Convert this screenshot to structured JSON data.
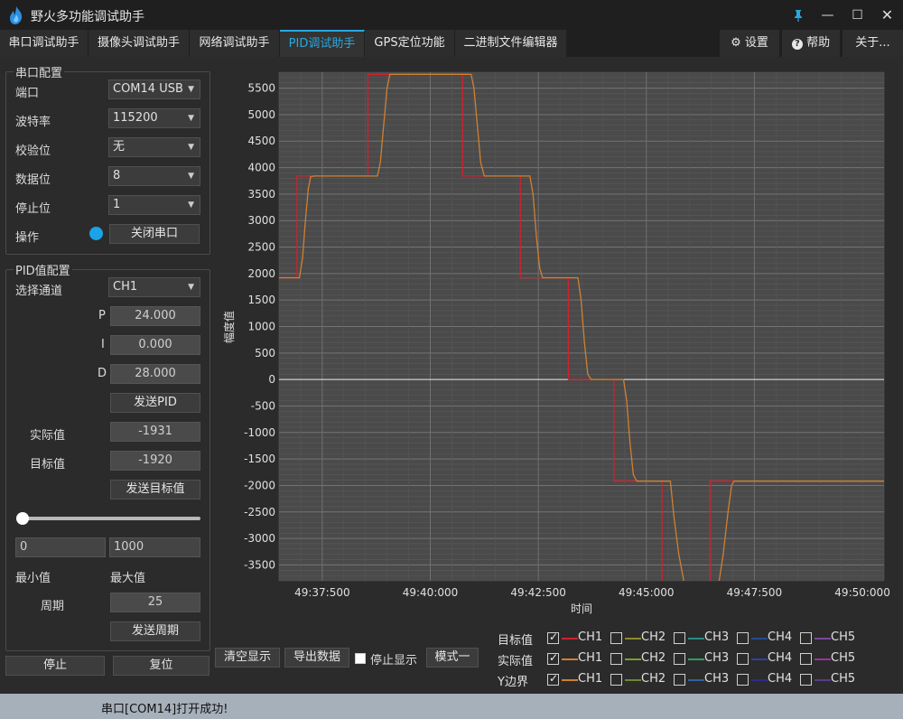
{
  "window": {
    "title": "野火多功能调试助手"
  },
  "tabs": [
    {
      "label": "串口调试助手"
    },
    {
      "label": "摄像头调试助手"
    },
    {
      "label": "网络调试助手"
    },
    {
      "label": "PID调试助手"
    },
    {
      "label": "GPS定位功能"
    },
    {
      "label": "二进制文件编辑器"
    }
  ],
  "topbuttons": {
    "settings": "设置",
    "help": "帮助",
    "about": "关于..."
  },
  "serial": {
    "title": "串口配置",
    "port_label": "端口",
    "port_value": "COM14 USB",
    "baud_label": "波特率",
    "baud_value": "115200",
    "parity_label": "校验位",
    "parity_value": "无",
    "databits_label": "数据位",
    "databits_value": "8",
    "stopbits_label": "停止位",
    "stopbits_value": "1",
    "op_label": "操作",
    "close_button": "关闭串口"
  },
  "pid": {
    "title": "PID值配置",
    "channel_label": "选择通道",
    "channel_value": "CH1",
    "p_label": "P",
    "p_value": "24.000",
    "i_label": "I",
    "i_value": "0.000",
    "d_label": "D",
    "d_value": "28.000",
    "send_pid": "发送PID",
    "actual_label": "实际值",
    "actual_value": "-1931",
    "target_label": "目标值",
    "target_value": "-1920",
    "send_target": "发送目标值",
    "slider_min_value": "0",
    "slider_max_value": "1000",
    "min_label": "最小值",
    "max_label": "最大值",
    "period_label": "周期",
    "period_value": "25",
    "send_period": "发送周期"
  },
  "bottom": {
    "stop": "停止",
    "reset": "复位",
    "clear": "清空显示",
    "export": "导出数据",
    "stop_display": "停止显示",
    "mode": "模式一"
  },
  "legend": {
    "rows": [
      {
        "label": "目标值",
        "checked": [
          true,
          false,
          false,
          false,
          false
        ]
      },
      {
        "label": "实际值",
        "checked": [
          true,
          false,
          false,
          false,
          false
        ]
      },
      {
        "label": "Y边界",
        "checked": [
          true,
          false,
          false,
          false,
          false
        ]
      }
    ],
    "channels": [
      "CH1",
      "CH2",
      "CH3",
      "CH4",
      "CH5"
    ],
    "row_colors": [
      [
        "#d2202e",
        "#8a8a2a",
        "#2a8a8a",
        "#2a4a8a",
        "#7a4a9a"
      ],
      [
        "#d08030",
        "#7aa030",
        "#30a060",
        "#3040a0",
        "#a030a0"
      ],
      [
        "#d08030",
        "#6a8a30",
        "#3060a0",
        "#302a8a",
        "#5a3a8a"
      ]
    ]
  },
  "status": {
    "text": "串口[COM14]打开成功!"
  },
  "chart_data": {
    "type": "line",
    "xlabel": "时间",
    "ylabel": "幅度值",
    "ylim": [
      -3800,
      5800
    ],
    "xlim": [
      "49:35:90",
      "50:14:20"
    ],
    "y_ticks": [
      5500,
      5000,
      4500,
      4000,
      3500,
      3000,
      2500,
      2000,
      1500,
      1000,
      500,
      0,
      -500,
      -1000,
      -1500,
      -2000,
      -2500,
      -3000,
      -3500
    ],
    "x_ticks": [
      "49:37:500",
      "49:40:000",
      "49:42:500",
      "49:45:000",
      "49:47:500",
      "49:50:000"
    ],
    "series": [
      {
        "name": "目标值 CH1",
        "color": "#d2202e",
        "points": [
          [
            0,
            1920
          ],
          [
            75,
            1920
          ],
          [
            75,
            3840
          ],
          [
            370,
            3840
          ],
          [
            370,
            5760
          ],
          [
            765,
            5760
          ],
          [
            765,
            3840
          ],
          [
            1005,
            3840
          ],
          [
            1005,
            1920
          ],
          [
            1205,
            1920
          ],
          [
            1205,
            0
          ],
          [
            1395,
            0
          ],
          [
            1395,
            -1920
          ],
          [
            1595,
            -1920
          ],
          [
            1595,
            -3900
          ],
          [
            1795,
            -3900
          ],
          [
            1795,
            -1920
          ],
          [
            2520,
            -1920
          ]
        ]
      },
      {
        "name": "实际值 CH1",
        "color": "#d08030",
        "points": [
          [
            0,
            1920
          ],
          [
            85,
            1920
          ],
          [
            98,
            2300
          ],
          [
            110,
            3000
          ],
          [
            122,
            3600
          ],
          [
            132,
            3830
          ],
          [
            150,
            3840
          ],
          [
            410,
            3840
          ],
          [
            422,
            4100
          ],
          [
            436,
            4800
          ],
          [
            450,
            5500
          ],
          [
            462,
            5760
          ],
          [
            800,
            5760
          ],
          [
            812,
            5500
          ],
          [
            826,
            4800
          ],
          [
            840,
            4100
          ],
          [
            855,
            3840
          ],
          [
            1045,
            3840
          ],
          [
            1058,
            3500
          ],
          [
            1072,
            2700
          ],
          [
            1086,
            2100
          ],
          [
            1098,
            1920
          ],
          [
            1245,
            1920
          ],
          [
            1258,
            1500
          ],
          [
            1272,
            700
          ],
          [
            1286,
            100
          ],
          [
            1300,
            0
          ],
          [
            1435,
            0
          ],
          [
            1448,
            -400
          ],
          [
            1462,
            -1200
          ],
          [
            1476,
            -1800
          ],
          [
            1490,
            -1920
          ],
          [
            1630,
            -1920
          ],
          [
            1645,
            -2600
          ],
          [
            1665,
            -3300
          ],
          [
            1690,
            -3900
          ],
          [
            1830,
            -3900
          ],
          [
            1850,
            -3300
          ],
          [
            1870,
            -2500
          ],
          [
            1885,
            -2000
          ],
          [
            1895,
            -1920
          ],
          [
            2520,
            -1920
          ]
        ]
      }
    ],
    "x_range": [
      0,
      2520
    ]
  }
}
